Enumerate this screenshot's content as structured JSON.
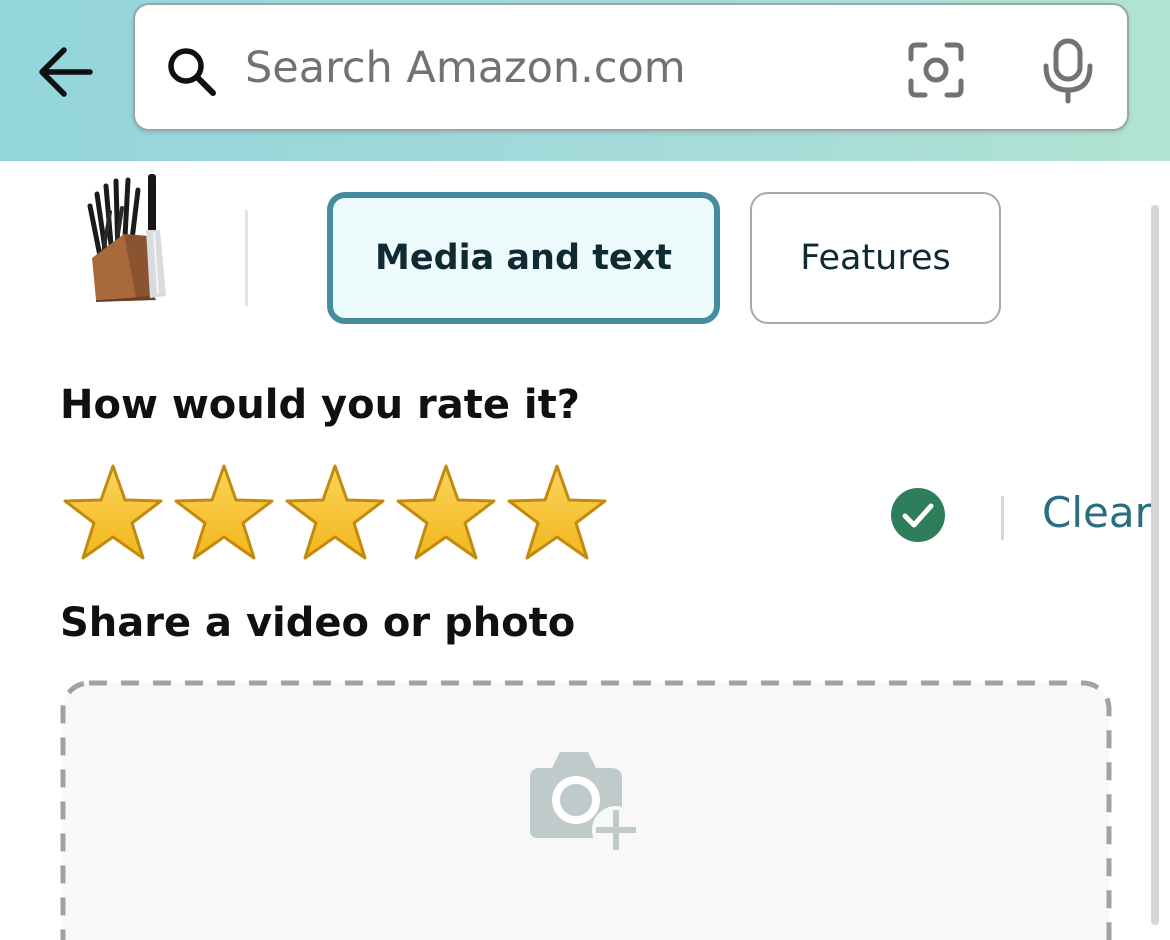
{
  "search": {
    "placeholder": "Search Amazon.com",
    "value": ""
  },
  "icons": {
    "back": "arrow-left-icon",
    "search": "magnifier-icon",
    "camera_search": "lens-camera-icon",
    "voice": "microphone-icon",
    "rating_confirmed": "check-circle-icon",
    "media_upload": "camera-plus-icon"
  },
  "tabs": [
    {
      "label": "Media and text",
      "selected": true
    },
    {
      "label": "Features",
      "selected": false
    }
  ],
  "rating": {
    "heading": "How would you rate it?",
    "value": 5,
    "max": 5,
    "clear_label": "Clear"
  },
  "media": {
    "heading": "Share a video or photo"
  },
  "colors": {
    "header_gradient_start": "#93d5db",
    "header_gradient_end": "#b2e3d2",
    "selected_tab_border": "#438d9e",
    "selected_tab_bg": "#eefbfd",
    "star_fill": "#f3b61e",
    "star_outline": "#c48a0d",
    "check_green": "#2e7d5b",
    "link_teal": "#2a6d7e"
  }
}
